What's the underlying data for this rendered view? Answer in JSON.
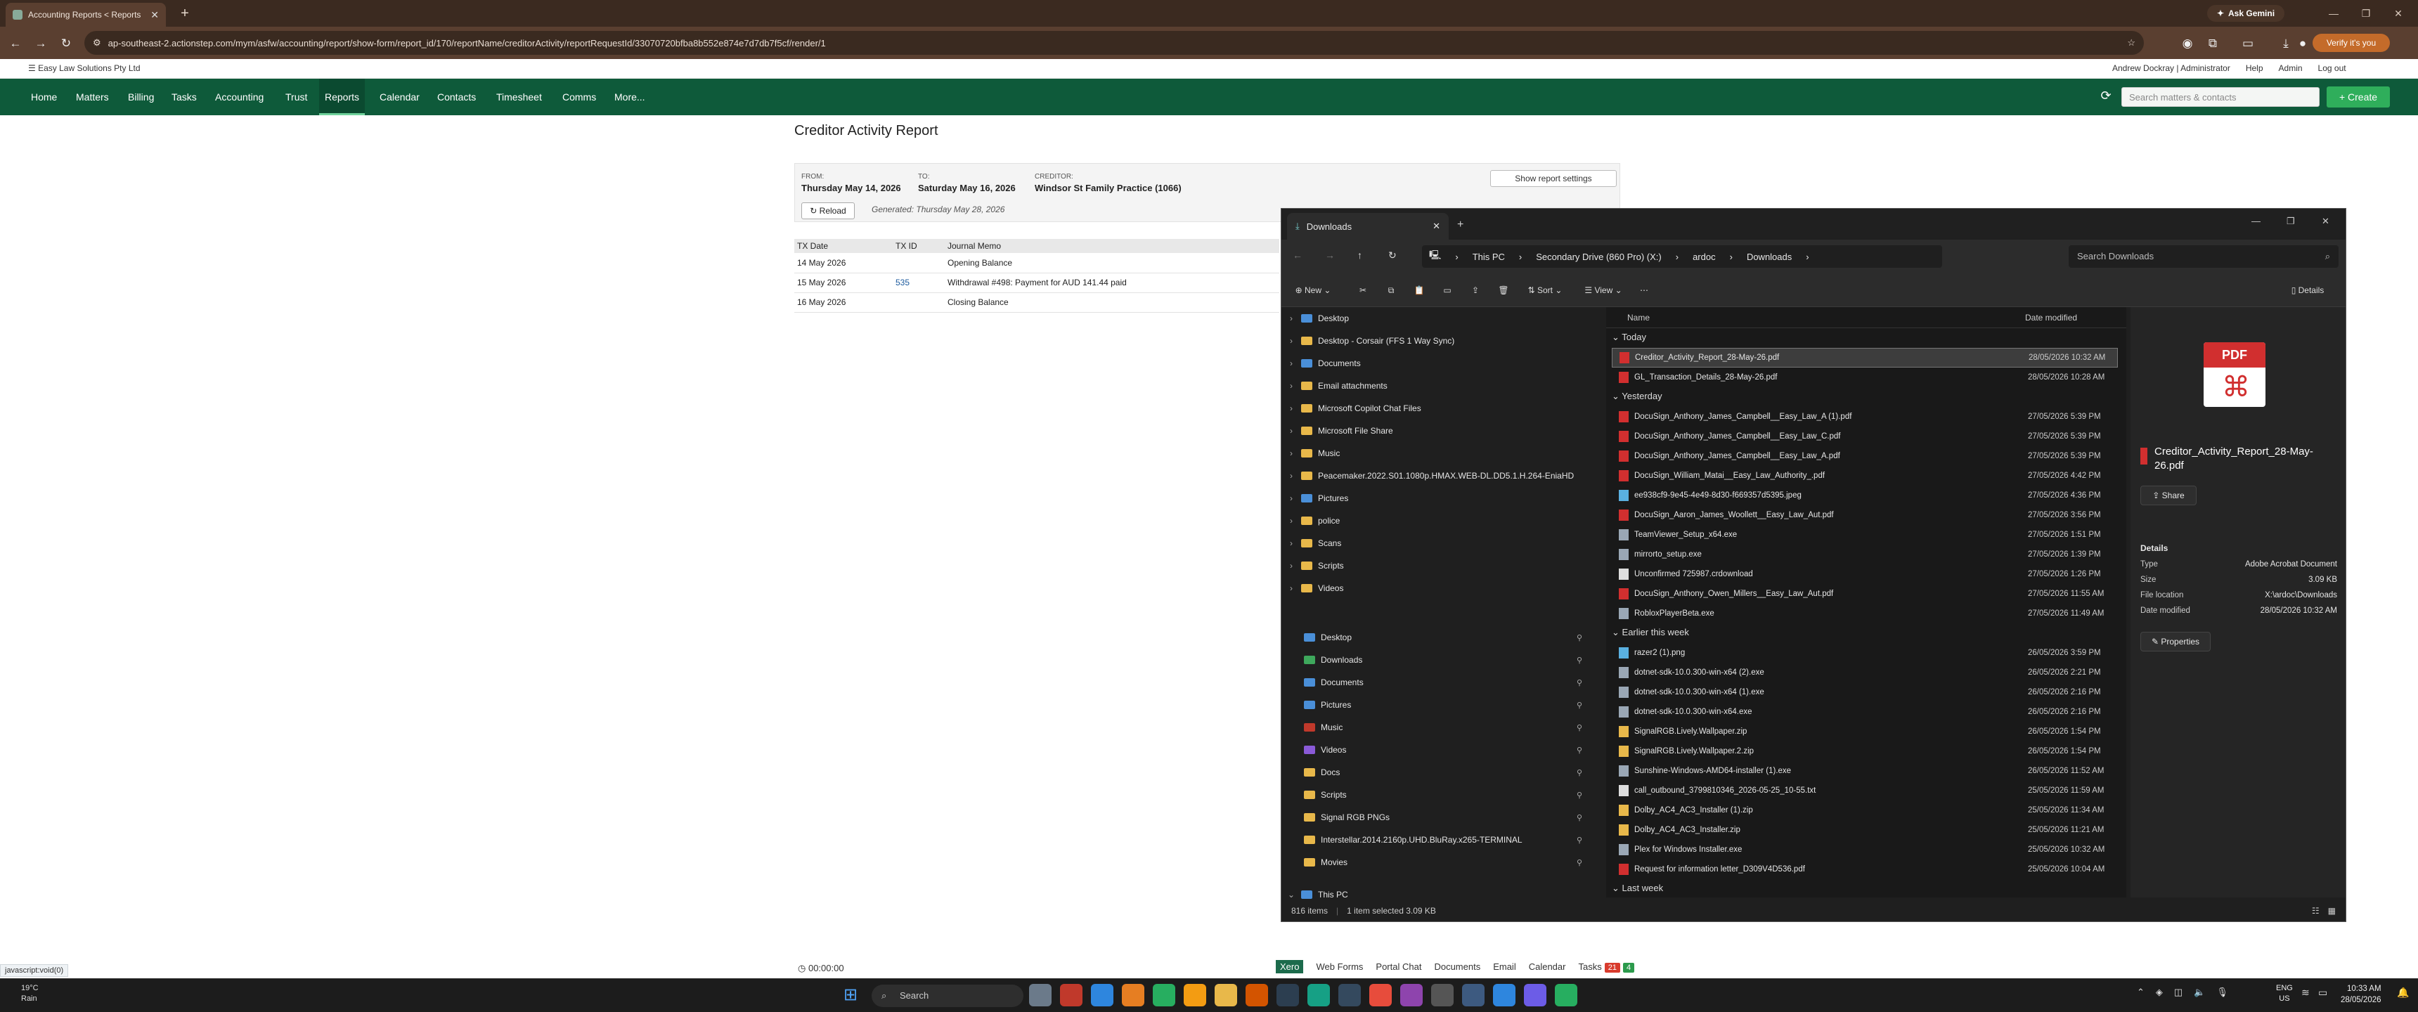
{
  "browser": {
    "tab_title": "Accounting Reports < Reports",
    "url": "ap-southeast-2.actionstep.com/mym/asfw/accounting/report/show-form/report_id/170/reportName/creditorActivity/reportRequestId/33070720bfba8b552e874e7d7db7f5cf/render/1",
    "ask_gemini": "Ask Gemini",
    "verify": "Verify it's you",
    "status_url": "javascript:void(0)"
  },
  "app": {
    "firm_name": "Easy Law Solutions Pty Ltd",
    "user": "Andrew Dockray | Administrator",
    "help": "Help",
    "admin": "Admin",
    "logout": "Log out",
    "nav": [
      "Home",
      "Matters",
      "Billing",
      "Tasks",
      "Accounting",
      "Trust",
      "Reports",
      "Calendar",
      "Contacts",
      "Timesheet",
      "Comms",
      "More..."
    ],
    "active_nav": "Reports",
    "search_placeholder": "Search matters & contacts",
    "create": "+ Create"
  },
  "report": {
    "title": "Creditor Activity Report",
    "from_label": "FROM:",
    "from_value": "Thursday May 14, 2026",
    "to_label": "TO:",
    "to_value": "Saturday May 16, 2026",
    "creditor_label": "CREDITOR:",
    "creditor_value": "Windsor St Family Practice (1066)",
    "reload": "Reload",
    "generated": "Generated: Thursday May 28, 2026",
    "show_settings": "Show report settings",
    "columns": [
      "TX Date",
      "TX ID",
      "Journal Memo"
    ],
    "rows": [
      {
        "date": "14 May 2026",
        "id": "",
        "memo": "Opening Balance"
      },
      {
        "date": "15 May 2026",
        "id": "535",
        "memo": "Withdrawal #498: Payment for AUD 141.44 paid"
      },
      {
        "date": "16 May 2026",
        "id": "",
        "memo": "Closing Balance"
      }
    ]
  },
  "footer": {
    "timer": "00:00:00",
    "links": [
      "Xero",
      "Web Forms",
      "Portal Chat",
      "Documents",
      "Email",
      "Calendar",
      "Tasks"
    ],
    "tasks_red": "21",
    "tasks_green": "4"
  },
  "explorer": {
    "tab_title": "Downloads",
    "crumbs": [
      "This PC",
      "Secondary Drive (860 Pro) (X:)",
      "ardoc",
      "Downloads"
    ],
    "search_placeholder": "Search Downloads",
    "commands": {
      "new": "New",
      "sort": "Sort",
      "view": "View",
      "details": "Details"
    },
    "nav_tree": [
      {
        "label": "Desktop",
        "color": "blue"
      },
      {
        "label": "Desktop - Corsair (FFS 1 Way Sync)",
        "color": "yellow"
      },
      {
        "label": "Documents",
        "color": "blue"
      },
      {
        "label": "Email attachments",
        "color": "yellow"
      },
      {
        "label": "Microsoft Copilot Chat Files",
        "color": "yellow"
      },
      {
        "label": "Microsoft File Share",
        "color": "yellow"
      },
      {
        "label": "Music",
        "color": "yellow"
      },
      {
        "label": "Peacemaker.2022.S01.1080p.HMAX.WEB-DL.DD5.1.H.264-EniaHD",
        "color": "yellow"
      },
      {
        "label": "Pictures",
        "color": "blue"
      },
      {
        "label": "police",
        "color": "yellow"
      },
      {
        "label": "Scans",
        "color": "yellow"
      },
      {
        "label": "Scripts",
        "color": "yellow"
      },
      {
        "label": "Videos",
        "color": "yellow"
      }
    ],
    "quick_access": [
      {
        "label": "Desktop",
        "color": "blue"
      },
      {
        "label": "Downloads",
        "color": "grn"
      },
      {
        "label": "Documents",
        "color": "blue"
      },
      {
        "label": "Pictures",
        "color": "blue"
      },
      {
        "label": "Music",
        "color": "red"
      },
      {
        "label": "Videos",
        "color": "prp"
      },
      {
        "label": "Docs",
        "color": "yellow"
      },
      {
        "label": "Scripts",
        "color": "yellow"
      },
      {
        "label": "Signal RGB PNGs",
        "color": "yellow"
      },
      {
        "label": "Interstellar.2014.2160p.UHD.BluRay.x265-TERMINAL",
        "color": "yellow"
      },
      {
        "label": "Movies",
        "color": "yellow"
      }
    ],
    "this_pc": "This PC",
    "columns": {
      "name": "Name",
      "date": "Date modified"
    },
    "groups": {
      "today": "Today",
      "yesterday": "Yesterday",
      "earlier": "Earlier this week",
      "last_week": "Last week"
    },
    "files_today": [
      {
        "name": "Creditor_Activity_Report_28-May-26.pdf",
        "date": "28/05/2026 10:32 AM",
        "type": "pdf"
      },
      {
        "name": "GL_Transaction_Details_28-May-26.pdf",
        "date": "28/05/2026 10:28 AM",
        "type": "pdf"
      }
    ],
    "files_yesterday": [
      {
        "name": "DocuSign_Anthony_James_Campbell__Easy_Law_A (1).pdf",
        "date": "27/05/2026 5:39 PM",
        "type": "pdf"
      },
      {
        "name": "DocuSign_Anthony_James_Campbell__Easy_Law_C.pdf",
        "date": "27/05/2026 5:39 PM",
        "type": "pdf"
      },
      {
        "name": "DocuSign_Anthony_James_Campbell__Easy_Law_A.pdf",
        "date": "27/05/2026 5:39 PM",
        "type": "pdf"
      },
      {
        "name": "DocuSign_William_Matai__Easy_Law_Authority_.pdf",
        "date": "27/05/2026 4:42 PM",
        "type": "pdf"
      },
      {
        "name": "ee938cf9-9e45-4e49-8d30-f669357d5395.jpeg",
        "date": "27/05/2026 4:36 PM",
        "type": "img"
      },
      {
        "name": "DocuSign_Aaron_James_Woollett__Easy_Law_Aut.pdf",
        "date": "27/05/2026 3:56 PM",
        "type": "pdf"
      },
      {
        "name": "TeamViewer_Setup_x64.exe",
        "date": "27/05/2026 1:51 PM",
        "type": "exe"
      },
      {
        "name": "mirrorto_setup.exe",
        "date": "27/05/2026 1:39 PM",
        "type": "exe"
      },
      {
        "name": "Unconfirmed 725987.crdownload",
        "date": "27/05/2026 1:26 PM",
        "type": "doc"
      },
      {
        "name": "DocuSign_Anthony_Owen_Millers__Easy_Law_Aut.pdf",
        "date": "27/05/2026 11:55 AM",
        "type": "pdf"
      },
      {
        "name": "RobloxPlayerBeta.exe",
        "date": "27/05/2026 11:49 AM",
        "type": "exe"
      }
    ],
    "files_earlier": [
      {
        "name": "razer2 (1).png",
        "date": "26/05/2026 3:59 PM",
        "type": "img"
      },
      {
        "name": "dotnet-sdk-10.0.300-win-x64 (2).exe",
        "date": "26/05/2026 2:21 PM",
        "type": "exe"
      },
      {
        "name": "dotnet-sdk-10.0.300-win-x64 (1).exe",
        "date": "26/05/2026 2:16 PM",
        "type": "exe"
      },
      {
        "name": "dotnet-sdk-10.0.300-win-x64.exe",
        "date": "26/05/2026 2:16 PM",
        "type": "exe"
      },
      {
        "name": "SignalRGB.Lively.Wallpaper.zip",
        "date": "26/05/2026 1:54 PM",
        "type": "zip"
      },
      {
        "name": "SignalRGB.Lively.Wallpaper.2.zip",
        "date": "26/05/2026 1:54 PM",
        "type": "zip"
      },
      {
        "name": "Sunshine-Windows-AMD64-installer (1).exe",
        "date": "26/05/2026 11:52 AM",
        "type": "exe"
      },
      {
        "name": "call_outbound_3799810346_2026-05-25_10-55.txt",
        "date": "25/05/2026 11:59 AM",
        "type": "doc"
      },
      {
        "name": "Dolby_AC4_AC3_Installer (1).zip",
        "date": "25/05/2026 11:34 AM",
        "type": "zip"
      },
      {
        "name": "Dolby_AC4_AC3_Installer.zip",
        "date": "25/05/2026 11:21 AM",
        "type": "zip"
      },
      {
        "name": "Plex for Windows Installer.exe",
        "date": "25/05/2026 10:32 AM",
        "type": "exe"
      },
      {
        "name": "Request for information letter_D309V4D536.pdf",
        "date": "25/05/2026 10:04 AM",
        "type": "pdf"
      }
    ],
    "details": {
      "file_name": "Creditor_Activity_Report_28-May-26.pdf",
      "share": "Share",
      "heading": "Details",
      "type_label": "Type",
      "type_value": "Adobe Acrobat Document",
      "size_label": "Size",
      "size_value": "3.09 KB",
      "location_label": "File location",
      "location_value": "X:\\ardoc\\Downloads",
      "modified_label": "Date modified",
      "modified_value": "28/05/2026 10:32 AM",
      "properties": "Properties",
      "pdf_badge": "PDF"
    },
    "status": {
      "items": "816 items",
      "selected": "1 item selected  3.09 KB"
    }
  },
  "taskbar": {
    "temp": "19°C",
    "condition": "Rain",
    "search": "Search",
    "lang": "ENG",
    "region": "US",
    "time": "10:33 AM",
    "date": "28/05/2026"
  }
}
